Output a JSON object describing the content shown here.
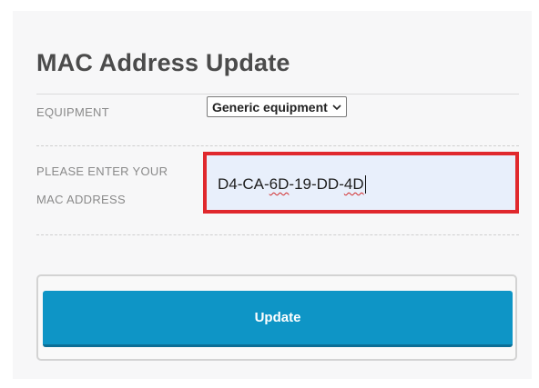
{
  "page": {
    "title": "MAC Address Update"
  },
  "equipment": {
    "label": "EQUIPMENT",
    "selected": "Generic equipment"
  },
  "mac": {
    "label_line1": "PLEASE ENTER YOUR",
    "label_line2": "MAC ADDRESS",
    "parts": [
      "D4-CA-",
      "6D",
      "-19-DD-",
      "4D"
    ]
  },
  "actions": {
    "update_label": "Update"
  },
  "colors": {
    "accent": "#0e95c6",
    "highlight_border": "#e0282d",
    "input_bg": "#e8effb"
  }
}
